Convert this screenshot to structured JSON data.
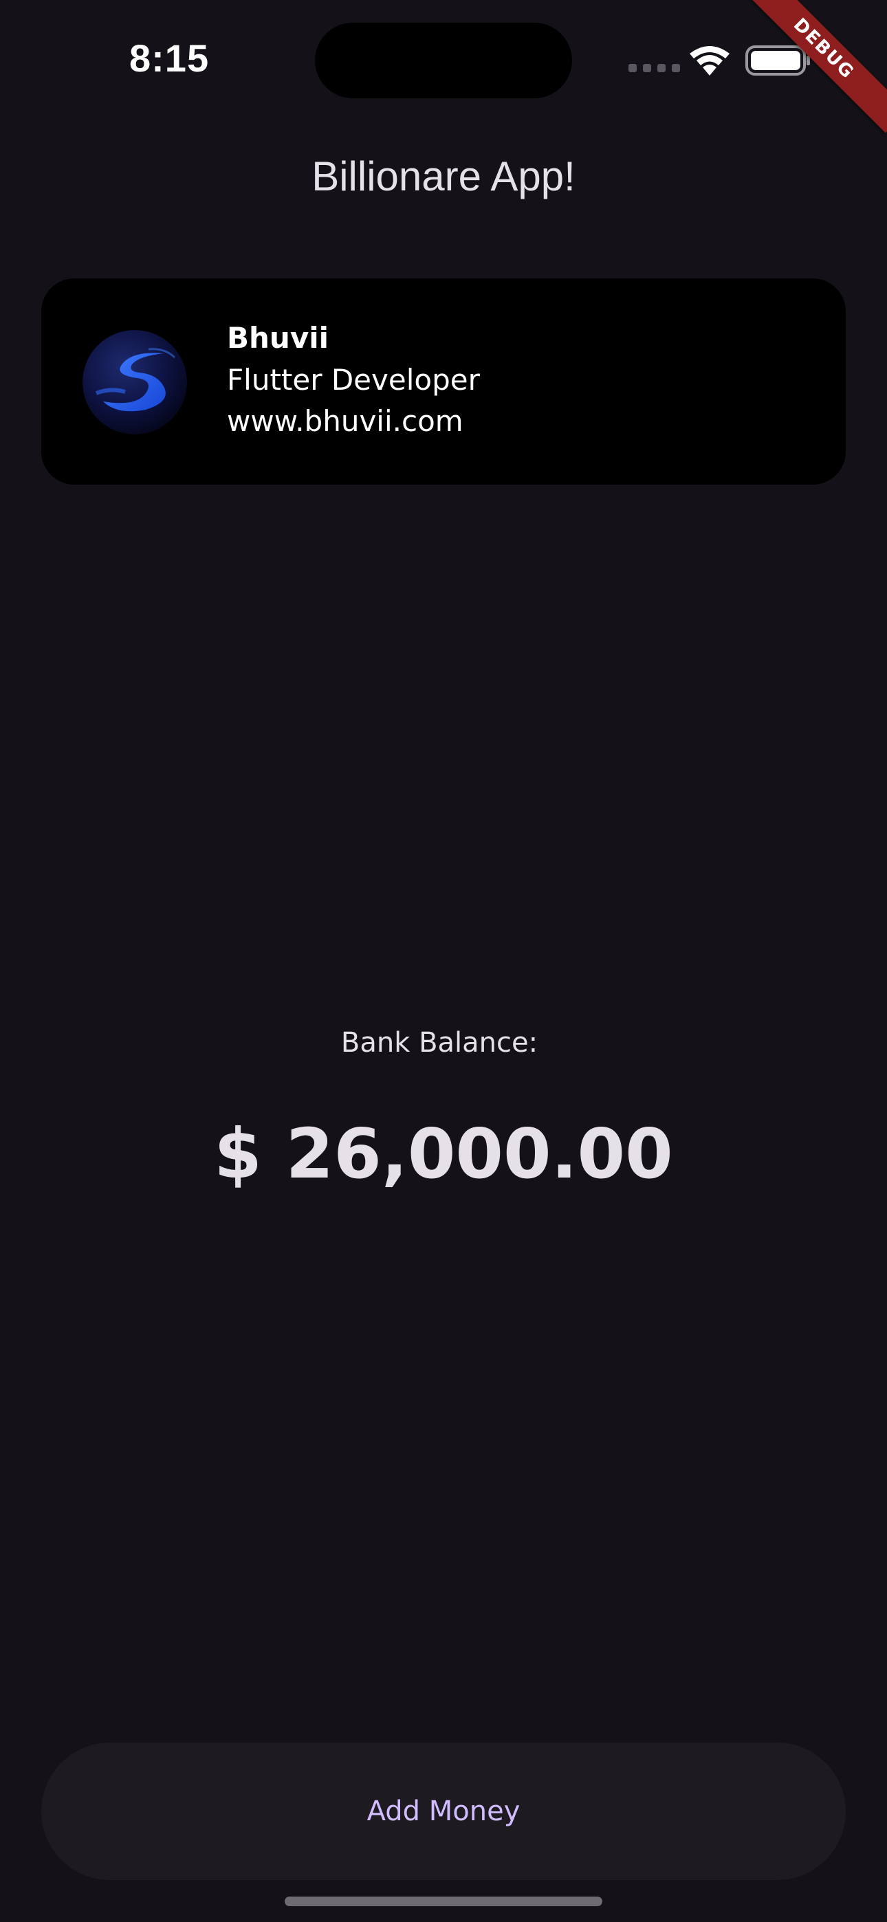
{
  "status_bar": {
    "time": "8:15"
  },
  "debug_banner": "DEBUG",
  "app_bar": {
    "title": "Billionare App!"
  },
  "profile": {
    "name": "Bhuvii",
    "role": "Flutter Developer",
    "website": "www.bhuvii.com",
    "avatar_icon": "bhuvii-logo-icon"
  },
  "balance": {
    "label": "Bank Balance:",
    "amount": "$ 26,000.00"
  },
  "actions": {
    "add_money_label": "Add Money"
  },
  "colors": {
    "background": "#141218",
    "card": "#000000",
    "button": "#1d1b20",
    "button_text": "#d0bcff",
    "debug_banner": "#8f1e1e"
  }
}
